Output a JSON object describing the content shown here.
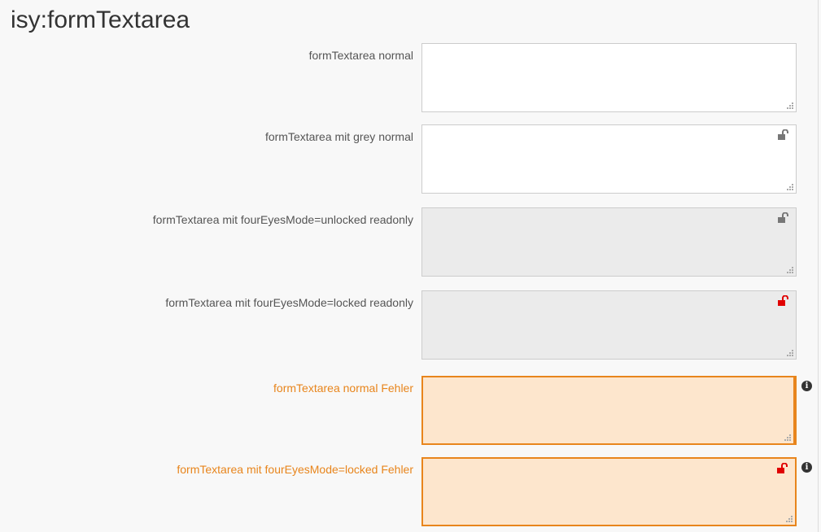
{
  "page": {
    "title": "isy:formTextarea"
  },
  "colors": {
    "error": "#e8851c",
    "error_bg": "#fde6cd",
    "readonly_bg": "#ebebeb",
    "lock_locked": "#e00000",
    "lock_unlocked": "#777777"
  },
  "fields": [
    {
      "label": "formTextarea normal",
      "value": "",
      "state": "normal",
      "lock": "none",
      "info_icon": false
    },
    {
      "label": "formTextarea mit grey normal",
      "value": "",
      "state": "normal",
      "lock": "unlocked-grey-icon",
      "info_icon": false
    },
    {
      "label": "formTextarea mit fourEyesMode=unlocked readonly",
      "value": "",
      "state": "readonly",
      "lock": "unlocked-grey-icon",
      "info_icon": false
    },
    {
      "label": "formTextarea mit fourEyesMode=locked readonly",
      "value": "",
      "state": "readonly",
      "lock": "locked-red-icon",
      "info_icon": false
    },
    {
      "label": "formTextarea normal Fehler",
      "value": "",
      "state": "error",
      "lock": "none",
      "info_icon": true,
      "info_symbol": "i"
    },
    {
      "label": "formTextarea mit fourEyesMode=locked Fehler",
      "value": "",
      "state": "error",
      "lock": "locked-red-icon",
      "info_icon": true,
      "info_symbol": "i"
    }
  ]
}
